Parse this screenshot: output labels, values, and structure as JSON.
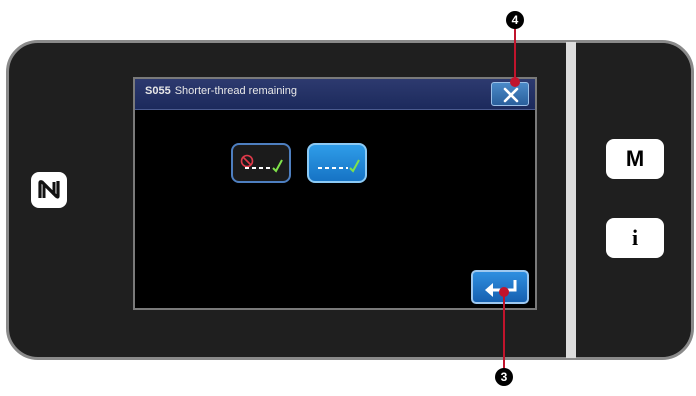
{
  "dialog": {
    "code": "S055",
    "title": "Shorter-thread remaining"
  },
  "options": [
    {
      "name": "shorter-thread-off",
      "icon": "no-short-thread-icon"
    },
    {
      "name": "shorter-thread-on",
      "icon": "short-thread-icon"
    }
  ],
  "side_buttons": {
    "mode": "M",
    "info": "i"
  },
  "callouts": {
    "close": "4",
    "enter": "3"
  },
  "icons": {
    "close": "close-icon",
    "enter": "enter-icon",
    "nfc": "nfc-icon"
  },
  "colors": {
    "titlebar": "#1c2a5c",
    "button_blue": "#1673c5",
    "callout_red": "#c0142c",
    "check_green": "#7fe24a"
  }
}
